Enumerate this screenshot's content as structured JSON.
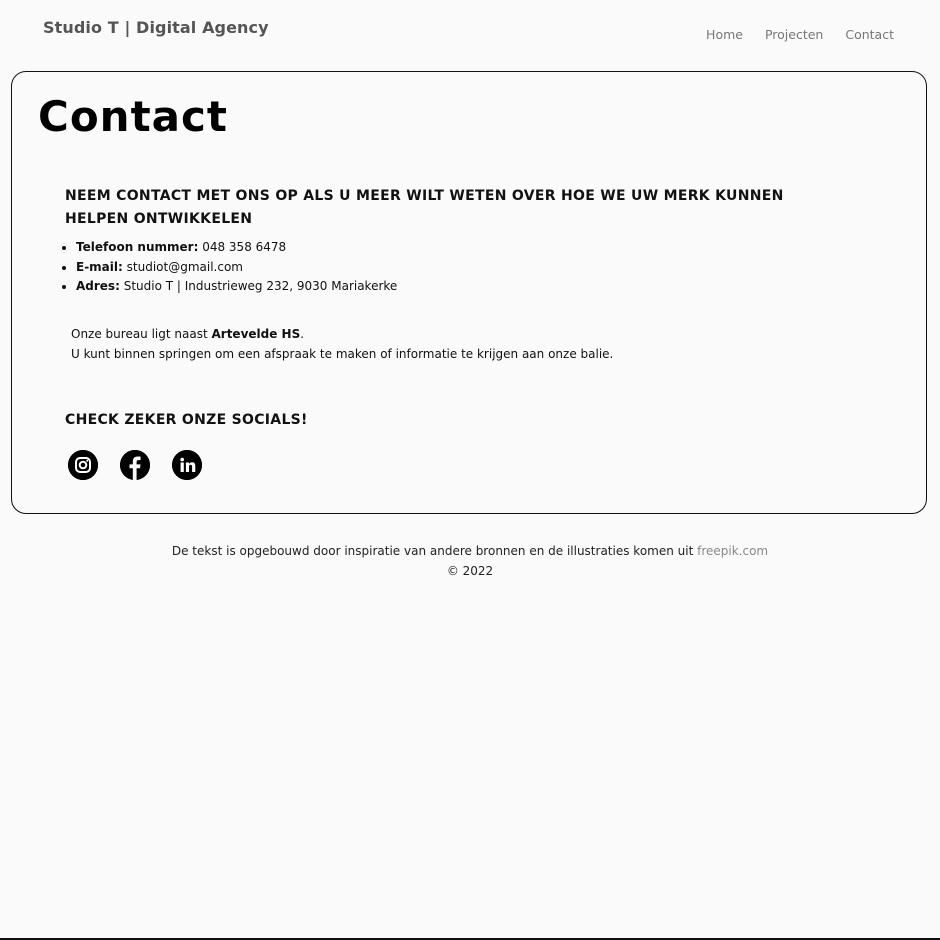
{
  "header": {
    "brand": "Studio T | Digital Agency",
    "nav": [
      {
        "label": "Home"
      },
      {
        "label": "Projecten"
      },
      {
        "label": "Contact"
      }
    ]
  },
  "main": {
    "title": "Contact",
    "lead": "Neem contact met ons op als u meer wilt weten over hoe we uw merk kunnen helpen ontwikkelen",
    "contacts": [
      {
        "label": "Telefoon nummer:",
        "value": "048 358 6478"
      },
      {
        "label": "E-mail:",
        "value": "studiot@gmail.com"
      },
      {
        "label": "Adres:",
        "value": "Studio T | Industrieweg 232, 9030 Mariakerke"
      }
    ],
    "info": {
      "line1_prefix": "Onze bureau ligt naast ",
      "line1_bold": "Artevelde HS",
      "line1_suffix": ".",
      "line2": "U kunt binnen springen om een afspraak te maken of informatie te krijgen aan onze balie."
    },
    "socials_heading": "Check zeker onze socials!",
    "socials": [
      {
        "icon": "instagram-icon"
      },
      {
        "icon": "facebook-icon"
      },
      {
        "icon": "linkedin-icon"
      }
    ]
  },
  "footer": {
    "text": "De tekst is opgebouwd door inspiratie van andere bronnen en de illustraties komen uit ",
    "link": "freepik.com",
    "copyright": "© 2022"
  },
  "colors": {
    "background": "#fafafa",
    "text": "#111111",
    "muted": "#777777",
    "link": "#888888"
  }
}
